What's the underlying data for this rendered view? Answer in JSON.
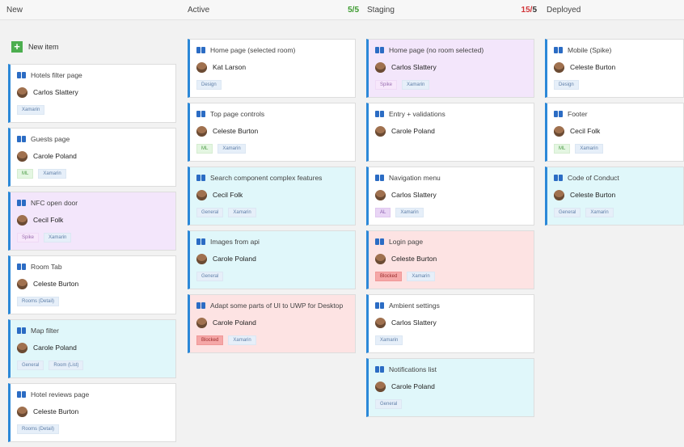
{
  "columns": [
    {
      "name": "New",
      "count": "",
      "max": "",
      "new_item_label": "New item"
    },
    {
      "name": "Active",
      "count": "5/",
      "max": "5",
      "new_item_label": ""
    },
    {
      "name": "Staging",
      "count": "15/",
      "max": "5",
      "new_item_label": ""
    },
    {
      "name": "Deployed",
      "count": "",
      "max": "",
      "new_item_label": ""
    }
  ],
  "cards": {
    "new": [
      {
        "title": "Hotels filter page",
        "person": "Carlos Slattery",
        "tags": [
          "Xamarin"
        ]
      },
      {
        "title": "Guests page",
        "person": "Carole Poland",
        "tags": [
          "ML",
          "Xamarin"
        ]
      },
      {
        "title": "NFC open door",
        "person": "Cecil Folk",
        "tags": [
          "Spike",
          "Xamarin"
        ]
      },
      {
        "title": "Room Tab",
        "person": "Celeste Burton",
        "tags": [
          "Rooms (Detail)"
        ]
      },
      {
        "title": "Map filter",
        "person": "Carole Poland",
        "tags": [
          "General",
          "Room (List)"
        ]
      },
      {
        "title": "Hotel reviews page",
        "person": "Celeste Burton",
        "tags": [
          "Rooms (Detail)"
        ]
      }
    ],
    "active": [
      {
        "title": "Home page (selected room)",
        "person": "Kat Larson",
        "tags": [
          "Design"
        ]
      },
      {
        "title": "Top page controls",
        "person": "Celeste Burton",
        "tags": [
          "ML",
          "Xamarin"
        ]
      },
      {
        "title": "Search component complex features",
        "person": "Cecil Folk",
        "tags": [
          "General",
          "Xamarin"
        ]
      },
      {
        "title": "Images from api",
        "person": "Carole Poland",
        "tags": [
          "General"
        ]
      },
      {
        "title": "Adapt some parts of UI to UWP for Desktop",
        "person": "Carole Poland",
        "tags": [
          "Blocked",
          "Xamarin"
        ]
      }
    ],
    "staging": [
      {
        "title": "Home page (no room selected)",
        "person": "Carlos Slattery",
        "tags": [
          "Spike",
          "Xamarin"
        ]
      },
      {
        "title": "Entry + validations",
        "person": "Carole Poland",
        "tags": []
      },
      {
        "title": "Navigation menu",
        "person": "Carlos Slattery",
        "tags": [
          "AL",
          "Xamarin"
        ]
      },
      {
        "title": "Login page",
        "person": "Celeste Burton",
        "tags": [
          "Blocked",
          "Xamarin"
        ]
      },
      {
        "title": "Ambient settings",
        "person": "Carlos Slattery",
        "tags": [
          "Xamarin"
        ]
      },
      {
        "title": "Notifications list",
        "person": "Carole Poland",
        "tags": [
          "General"
        ]
      }
    ],
    "deployed": [
      {
        "title": "Mobile (Spike)",
        "person": "Celeste Burton",
        "tags": [
          "Design"
        ]
      },
      {
        "title": "Footer",
        "person": "Cecil Folk",
        "tags": [
          "ML",
          "Xamarin"
        ]
      },
      {
        "title": "Code of Conduct",
        "person": "Celeste Burton",
        "tags": [
          "General",
          "Xamarin"
        ]
      }
    ]
  }
}
